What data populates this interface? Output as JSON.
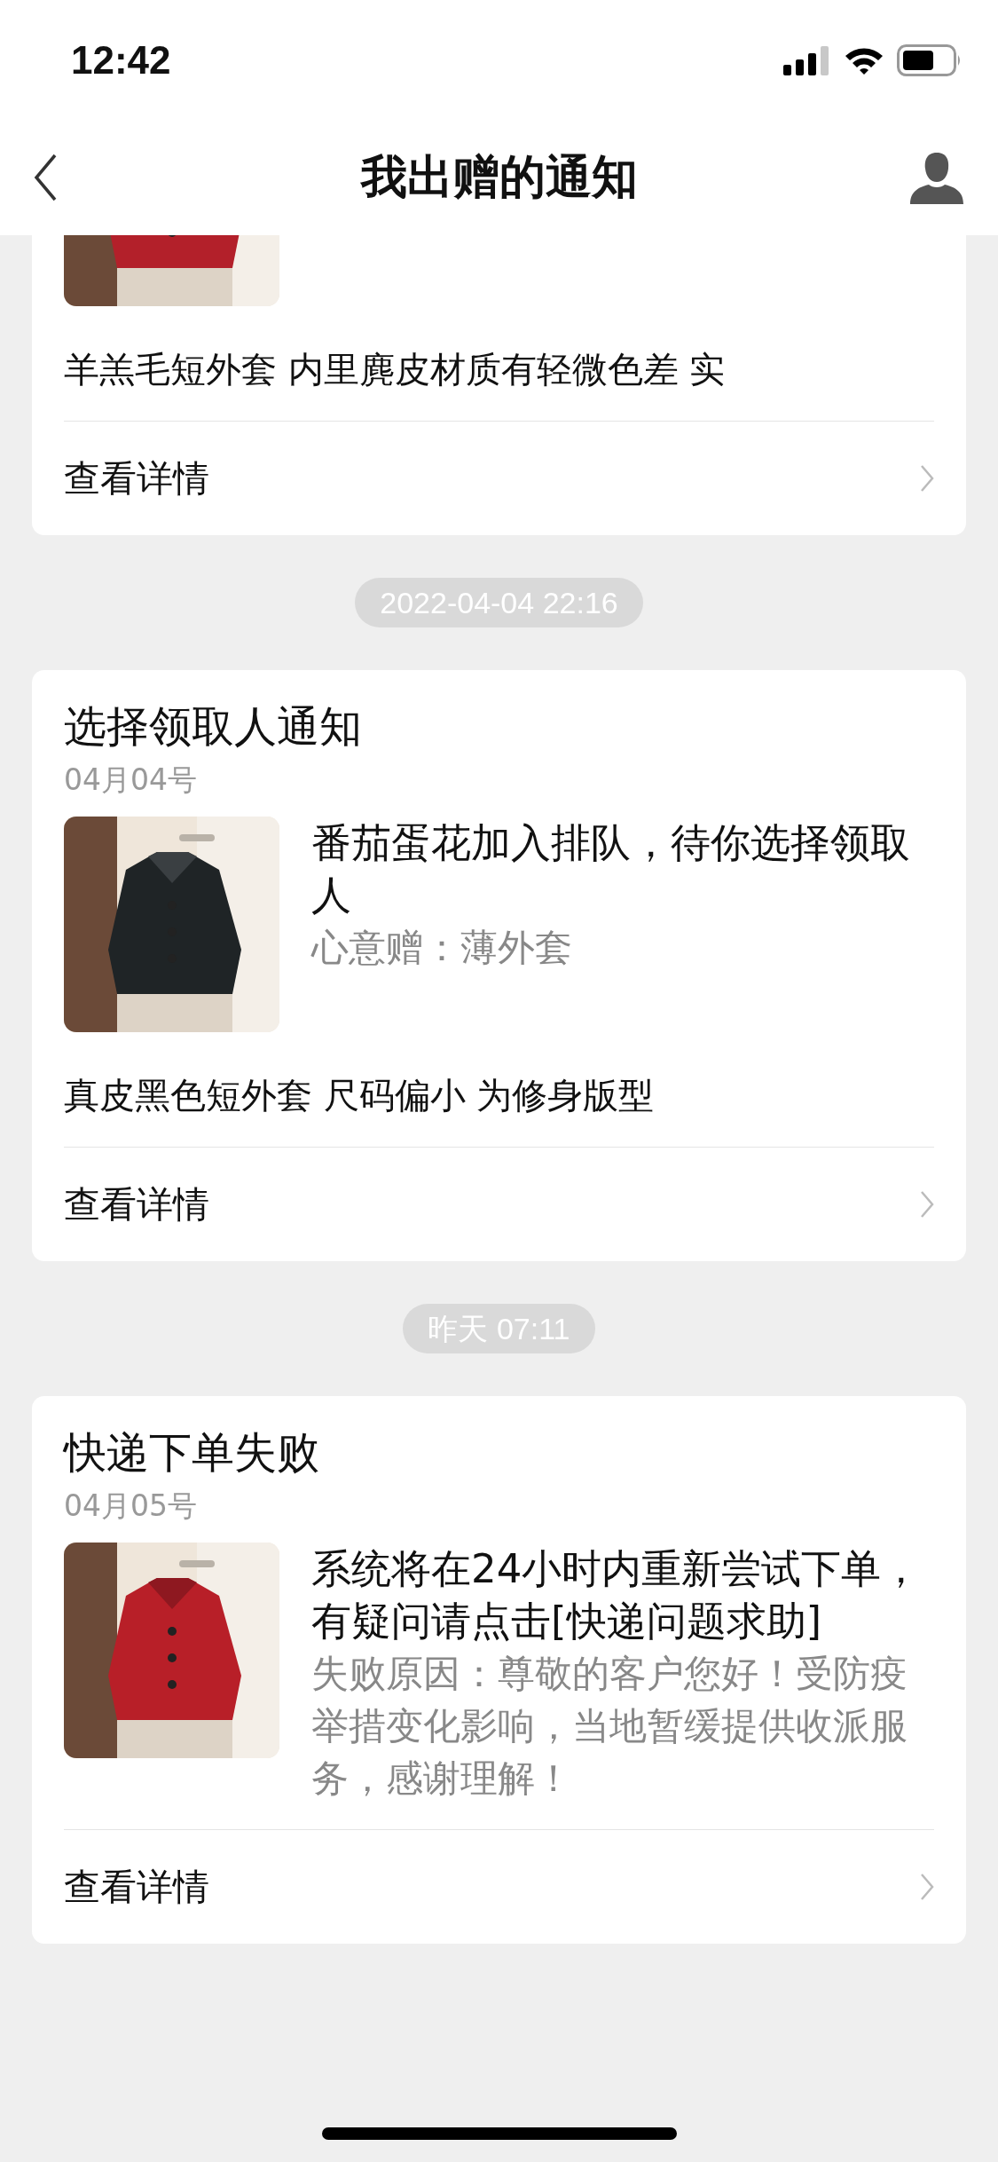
{
  "status_bar": {
    "time": "12:42"
  },
  "header": {
    "title": "我出赠的通知"
  },
  "notifications": [
    {
      "partial": true,
      "description": "羊羔毛短外套 内里麂皮材质有轻微色差 实",
      "link": "查看详情"
    },
    {
      "partial": false,
      "timestamp": "2022-04-04 22:16",
      "title": "选择领取人通知",
      "date": "04月04号",
      "message": "番茄蛋花加入排队，待你选择领取人",
      "subtitle": "心意赠：薄外套",
      "description": "真皮黑色短外套 尺码偏小 为修身版型",
      "link": "查看详情"
    },
    {
      "partial": false,
      "timestamp": "昨天 07:11",
      "title": "快递下单失败",
      "date": "04月05号",
      "message": "系统将在24小时内重新尝试下单，有疑问请点击[快递问题求助]",
      "subtitle": "失败原因：尊敬的客户您好！受防疫举措变化影响，当地暂缓提供收派服务，感谢理解！",
      "link": "查看详情"
    }
  ]
}
